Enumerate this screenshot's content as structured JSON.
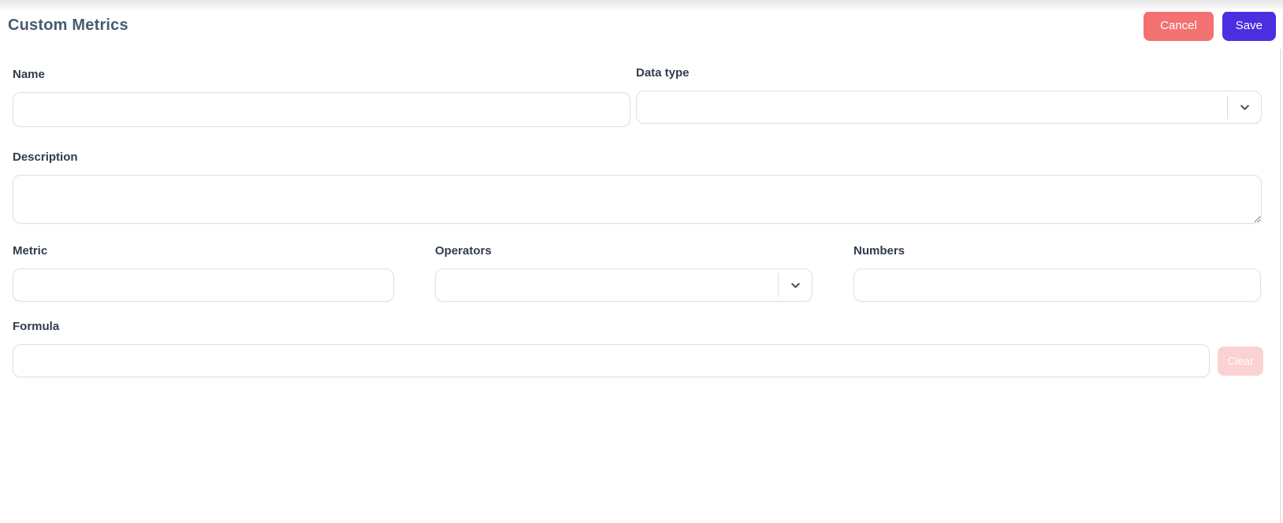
{
  "page": {
    "title": "Custom Metrics"
  },
  "header": {
    "cancel_label": "Cancel",
    "save_label": "Save"
  },
  "form": {
    "name": {
      "label": "Name",
      "value": "",
      "placeholder": ""
    },
    "data_type": {
      "label": "Data type",
      "selected_value": ""
    },
    "description": {
      "label": "Description",
      "value": "",
      "placeholder": ""
    },
    "metric": {
      "label": "Metric",
      "value": "",
      "placeholder": ""
    },
    "operators": {
      "label": "Operators",
      "selected_value": ""
    },
    "numbers": {
      "label": "Numbers",
      "value": "",
      "placeholder": ""
    },
    "formula": {
      "label": "Formula",
      "value": "",
      "placeholder": "",
      "clear_label": "Clear"
    }
  },
  "icons": {
    "data_type_chevron": "chevron-down-icon",
    "operators_chevron": "chevron-down-icon"
  },
  "colors": {
    "cancel_button": "#F47171",
    "save_button": "#4A2EE0",
    "clear_disabled_bg": "#FBD2D2",
    "title_text": "#475B72",
    "label_text": "#323C50",
    "input_border": "#E0E0E0",
    "chevron": "#4A5568",
    "top_gradient": "#E7E7E7"
  }
}
